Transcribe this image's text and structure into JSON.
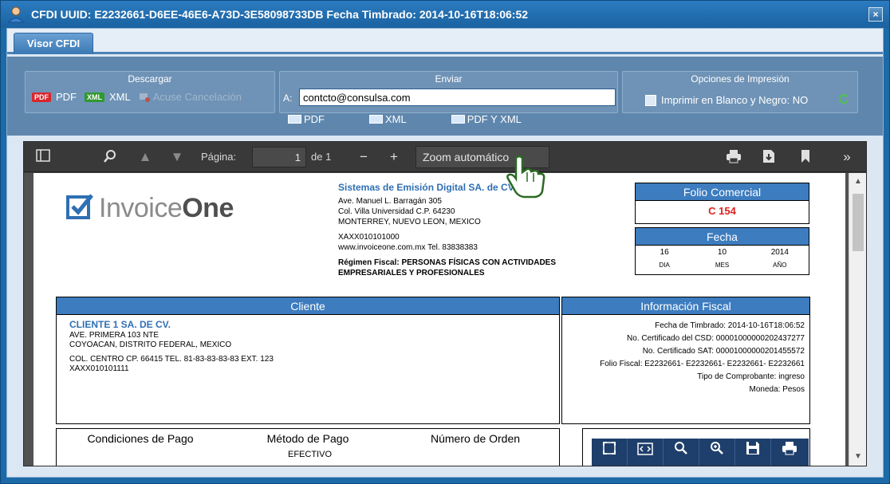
{
  "window": {
    "title": "CFDI UUID: E2232661-D6EE-46E6-A73D-3E58098733DB Fecha Timbrado: 2014-10-16T18:06:52",
    "close_label": "×"
  },
  "tabs": [
    {
      "label": "Visor CFDI"
    }
  ],
  "download": {
    "title": "Descargar",
    "pdf_badge": "PDF",
    "pdf_label": "PDF",
    "xml_badge": "XML",
    "xml_label": "XML",
    "cancel_label": "Acuse Cancelación"
  },
  "send": {
    "title": "Enviar",
    "to_label": "A:",
    "email_value": "contcto@consulsa.com",
    "pdf_label": "PDF",
    "xml_label": "XML",
    "both_label": "PDF Y XML"
  },
  "print_options": {
    "title": "Opciones de Impresión",
    "bw_label": "Imprimir en Blanco y Negro: NO"
  },
  "pdf_toolbar": {
    "page_label": "Página:",
    "page_value": "1",
    "page_total": "de 1",
    "zoom_label": "Zoom automático"
  },
  "invoice": {
    "logo_light": "Invoice",
    "logo_bold": "One",
    "company_name": "Sistemas de Emisión Digital  SA. de CV.",
    "address1": "Ave. Manuel L. Barragán  305",
    "address2": "Col. Villa Universidad    C.P. 64230",
    "address3": "MONTERREY, NUEVO LEON, MEXICO",
    "rfc": "XAXX010101000",
    "web": "www.invoiceone.com.mx   Tel. 83838383",
    "regime1": "Régimen Fiscal: PERSONAS FÍSICAS CON ACTIVIDADES",
    "regime2": "EMPRESARIALES Y PROFESIONALES",
    "folio_title": "Folio Comercial",
    "folio_value": "C 154",
    "fecha_title": "Fecha",
    "day": "16",
    "month": "10",
    "year": "2014",
    "day_label": "DIA",
    "month_label": "MES",
    "year_label": "AÑO",
    "cliente_title": "Cliente",
    "cliente_name": "CLIENTE 1 SA. DE CV.",
    "cliente_line1": "AVE. PRIMERA 103 NTE",
    "cliente_line2": "COYOACAN, DISTRITO FEDERAL, MEXICO",
    "cliente_line3": "COL. CENTRO  CP. 66415  TEL. 81-83-83-83-83 EXT. 123",
    "cliente_rfc": "XAXX010101111",
    "info_title": "Información Fiscal",
    "info_timbrado": "Fecha de Timbrado: 2014-10-16T18:06:52",
    "info_csd": "No. Certificado del CSD: 00001000000202437277",
    "info_sat": "No. Certificado SAT: 00001000000201455572",
    "info_folio": "Folio Fiscal: E2232661- E2232661- E2232661- E2232661",
    "info_tipo": "Tipo de Comprobante: ingreso",
    "info_moneda": "Moneda: Pesos",
    "pago_cond": "Condiciones de Pago",
    "pago_metodo": "Método de Pago",
    "pago_orden": "Número de Orden",
    "pago_metodo_value": "EFECTIVO"
  }
}
